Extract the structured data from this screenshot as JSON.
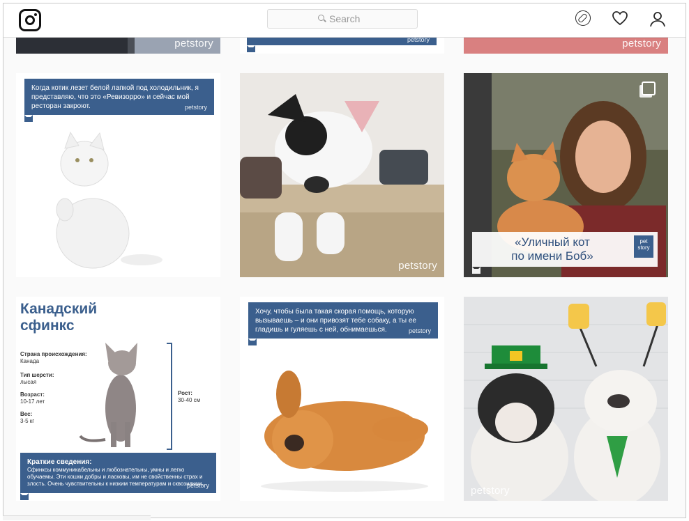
{
  "topbar": {
    "search_placeholder": "Search",
    "icons": [
      "instagram-logo-icon",
      "search-icon",
      "compass-icon",
      "heart-icon",
      "user-icon"
    ]
  },
  "posts": {
    "row0": {
      "p1": {
        "watermark": "petstory"
      },
      "p2": {
        "watermark": "petstory"
      },
      "p3": {
        "watermark": "petstory"
      }
    },
    "row1": {
      "p1": {
        "quote": "Когда котик лезет белой лапкой под холодильник, я представляю, что это «Ревизорро» и сейчас мой ресторан закроют.",
        "watermark": "petstory"
      },
      "p2": {
        "watermark": "petstory"
      },
      "p3": {
        "title_line1": "«Уличный кот",
        "title_line2": "по имени Боб»",
        "badge_line1": "pet",
        "badge_line2": "story"
      }
    },
    "row2": {
      "p1": {
        "title_line1": "Канадский",
        "title_line2": "сфинкс",
        "origin_label": "Страна происхождения:",
        "origin_value": "Канада",
        "coat_label": "Тип шерсти:",
        "coat_value": "лысая",
        "age_label": "Возраст:",
        "age_value": "10-17 лет",
        "weight_label": "Вес:",
        "weight_value": "3-5 кг",
        "height_label": "Рост:",
        "height_value": "30-40 см",
        "summary_title": "Краткие сведения:",
        "summary_text": "Сфинксы коммуникабельны и любознательны, умны и легко обучаемы. Эти кошки добры и ласковы, им не свойственны страх и злость. Очень чувствительны к низким температурам и сквознякам.",
        "watermark": "petstory"
      },
      "p2": {
        "quote": "Хочу, чтобы была такая скорая помощь, которую вызываешь – и они привозят тебе собаку, а ты ее гладишь и гуляешь с ней, обнимаешься.",
        "watermark": "petstory"
      },
      "p3": {
        "watermark": "petstory"
      }
    }
  },
  "colors": {
    "brand_blue": "#3b5f8d",
    "border": "#dbdbdb",
    "background": "#fafafa"
  }
}
